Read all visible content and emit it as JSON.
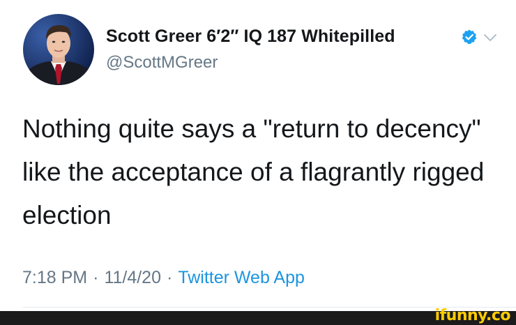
{
  "tweet": {
    "display_name": "Scott Greer 6′2″ IQ 187 Whitepilled",
    "handle": "@ScottMGreer",
    "text": "Nothing quite says a \"return to decency\" like the acceptance of a flagrantly rigged election",
    "time": "7:18 PM",
    "separator": "·",
    "date": "11/4/20",
    "source": "Twitter Web App",
    "verified": true
  },
  "icons": {
    "verified": "verified-badge-icon",
    "chevron": "chevron-down-icon"
  },
  "watermark": {
    "text": "ifunny.co"
  },
  "colors": {
    "name": "#14171a",
    "secondary": "#657786",
    "link": "#1b95e0",
    "verified": "#1da1f2",
    "watermark": "#ffcc00",
    "footer": "#1b1b1b"
  }
}
